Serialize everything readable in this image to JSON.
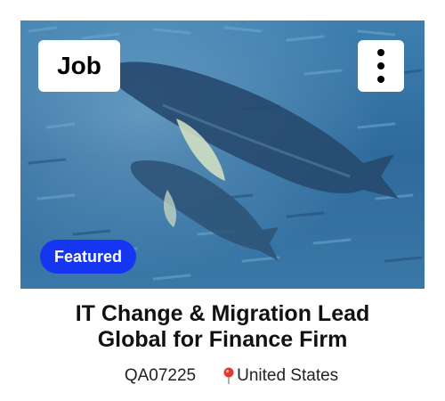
{
  "card": {
    "type_label": "Job",
    "featured_label": "Featured",
    "title_line1": "IT Change & Migration Lead",
    "title_line2": "Global for Finance Firm",
    "job_id": "QA07225",
    "location": "United States"
  },
  "icons": {
    "menu": "kebab-menu-icon",
    "location": "map-pin-icon"
  },
  "colors": {
    "featured_bg": "#1535f0",
    "pin": "#e03a2f",
    "ocean_dark": "#1f4f7a",
    "ocean_light": "#4c8fbf"
  }
}
